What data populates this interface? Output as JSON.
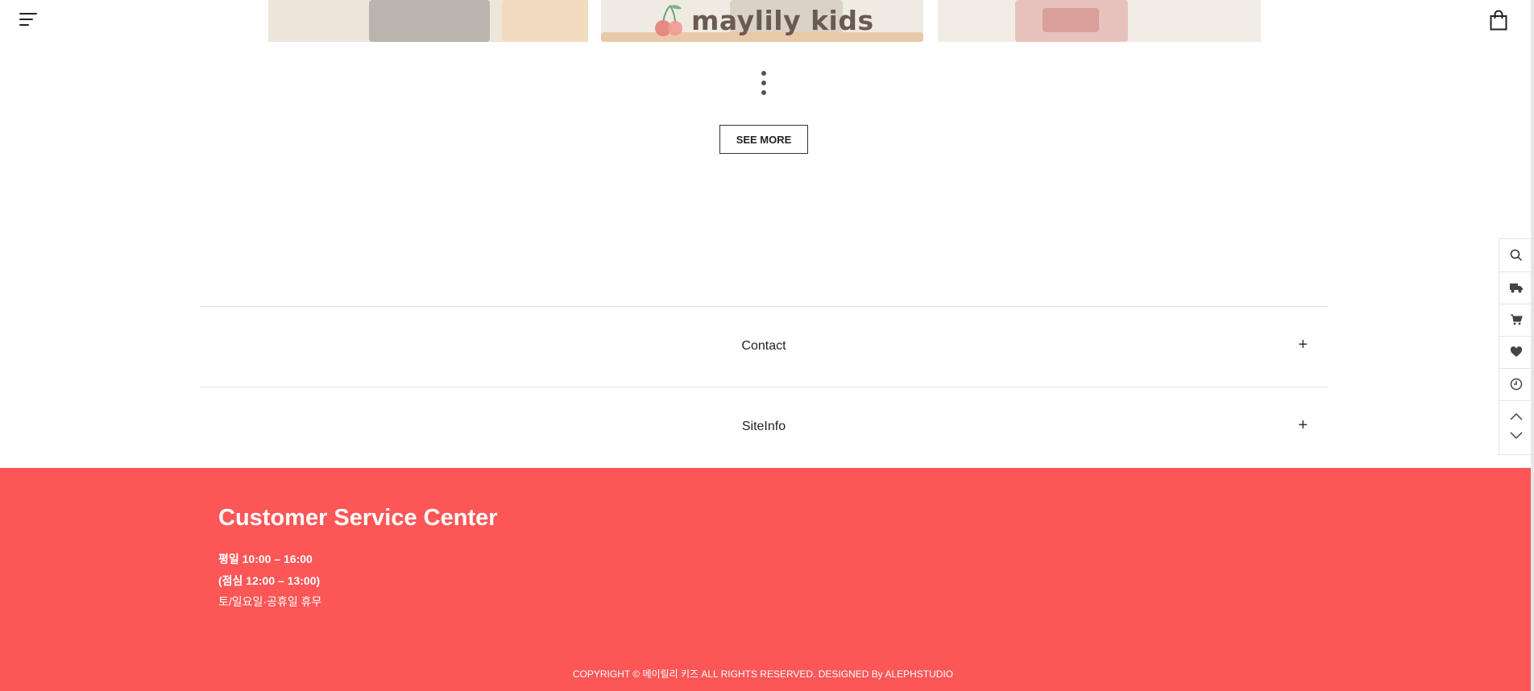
{
  "header": {
    "logo_text": "maylily kids",
    "menu_icon": "hamburger-icon",
    "bag_icon": "shopping-bag-icon"
  },
  "products": {
    "more_icon": "vertical-ellipsis-icon",
    "see_more_label": "SEE MORE"
  },
  "accordion": [
    {
      "label": "Contact",
      "toggle": "+"
    },
    {
      "label": "SiteInfo",
      "toggle": "+"
    }
  ],
  "quickbar": {
    "items": [
      "search-icon",
      "delivery-truck-icon",
      "cart-icon",
      "heart-icon",
      "clock-icon"
    ],
    "up_icon": "chevron-up-icon",
    "down_icon": "chevron-down-icon"
  },
  "footer": {
    "title": "Customer Service Center",
    "hours_weekday": "평일 10:00 – 16:00",
    "hours_lunch": "(점심 12:00 – 13:00)",
    "hours_closed": "토/일요일·공휴일 휴무",
    "copyright": "COPYRIGHT © 메이릴리 키즈 ALL RIGHTS RESERVED. DESIGNED By ALEPHSTUDIO"
  },
  "colors": {
    "footer_bg": "#fd5657",
    "logo_text": "#6b5a52",
    "logo_cherry": "#e7807a"
  }
}
